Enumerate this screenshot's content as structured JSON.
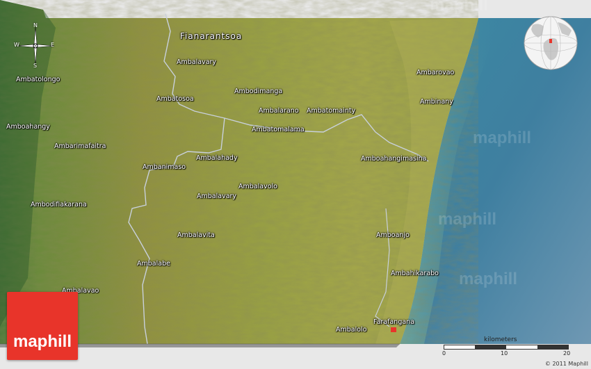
{
  "map": {
    "city": "Fianarantsoa",
    "places": [
      {
        "id": "ambalavary-n",
        "name": "Ambalavary"
      },
      {
        "id": "ambatolongo",
        "name": "Ambatolongo"
      },
      {
        "id": "ambodimanga",
        "name": "Ambodimanga"
      },
      {
        "id": "ambatosoa",
        "name": "Ambatosoa"
      },
      {
        "id": "ambalarano",
        "name": "Ambalarano"
      },
      {
        "id": "ambatomainty",
        "name": "Ambatomainty"
      },
      {
        "id": "ambarovao",
        "name": "Ambarovao"
      },
      {
        "id": "ambinany",
        "name": "Ambinany"
      },
      {
        "id": "amboahangy",
        "name": "Amboahangy"
      },
      {
        "id": "ambatomalama",
        "name": "Ambatomalama"
      },
      {
        "id": "ambarimafaitra",
        "name": "Ambarimafaitra"
      },
      {
        "id": "ambalahady",
        "name": "Ambalahady"
      },
      {
        "id": "amboahangimasina",
        "name": "Amboahangimasina"
      },
      {
        "id": "ambanimaso",
        "name": "Ambanimaso"
      },
      {
        "id": "ambalavolo",
        "name": "Ambalavolo"
      },
      {
        "id": "ambalavary-s",
        "name": "Ambalavary"
      },
      {
        "id": "ambodifiakarana",
        "name": "Ambodifiakarana"
      },
      {
        "id": "amboanjo",
        "name": "Amboanjo"
      },
      {
        "id": "ambalavita",
        "name": "Ambalavita"
      },
      {
        "id": "ambalabe",
        "name": "Ambalabe"
      },
      {
        "id": "ambahikarabo",
        "name": "Ambahikarabo"
      },
      {
        "id": "ambalavao",
        "name": "Ambalavao"
      },
      {
        "id": "farafangana",
        "name": "Farafangana"
      },
      {
        "id": "ambalolo",
        "name": "Ambalolo"
      }
    ]
  },
  "compass": {
    "n": "N",
    "s": "S",
    "e": "E",
    "w": "W"
  },
  "logo": {
    "text": "maphill"
  },
  "watermark": "maphill",
  "scale": {
    "title": "kilometers",
    "ticks": [
      "0",
      "10",
      "20"
    ]
  },
  "copyright": "© 2011 Maphill",
  "colors": {
    "logo": "#e8342a",
    "sea": "#3f86a0",
    "land": "#8a9a3e",
    "road": "#c8d0dc"
  }
}
